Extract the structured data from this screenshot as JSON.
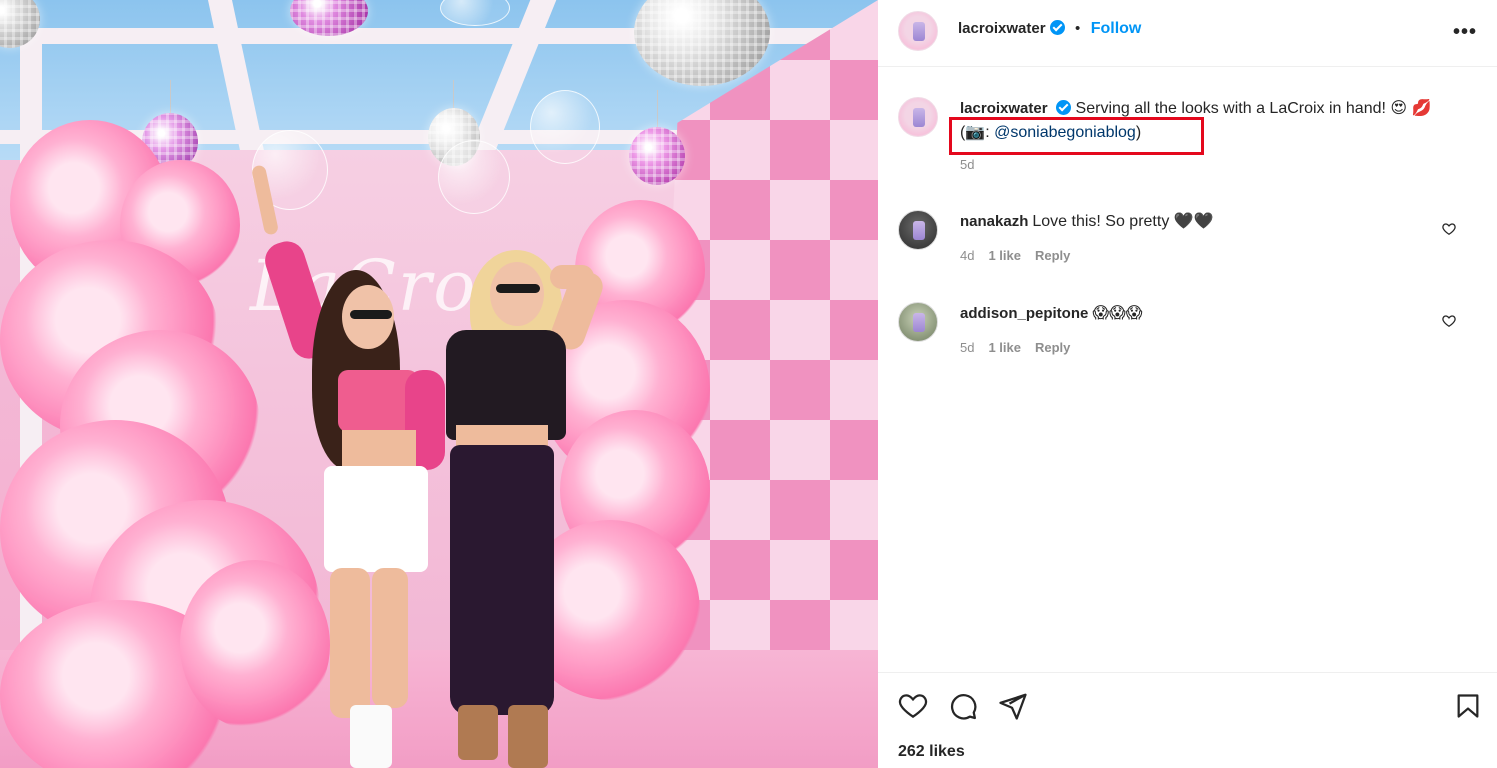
{
  "post": {
    "author": "lacroixwater",
    "follow_label": "Follow",
    "separator": "•",
    "more_label": "•••",
    "caption": {
      "username": "lacroixwater",
      "text": "Serving all the looks with a LaCroix in hand! 😍 💋",
      "credit_prefix": "(📷: ",
      "credit_handle": "@soniabegoniablog",
      "credit_suffix": ")",
      "age": "5d"
    },
    "comments": [
      {
        "username": "nanakazh",
        "text": "Love this! So pretty 🖤🖤",
        "age": "4d",
        "likes": "1 like",
        "reply": "Reply"
      },
      {
        "username": "addison_pepitone",
        "text": "😱😱😱",
        "age": "5d",
        "likes": "1 like",
        "reply": "Reply"
      }
    ],
    "likes_count": "262 likes"
  },
  "photo": {
    "sign_text": "LaCroix"
  },
  "colors": {
    "accent": "#0095f6",
    "highlight_box": "#e4081d",
    "muted": "#8e8e8e"
  },
  "icons": [
    "like-icon",
    "comment-icon",
    "share-icon",
    "save-icon",
    "comment-like-icon",
    "verified-badge-icon"
  ]
}
